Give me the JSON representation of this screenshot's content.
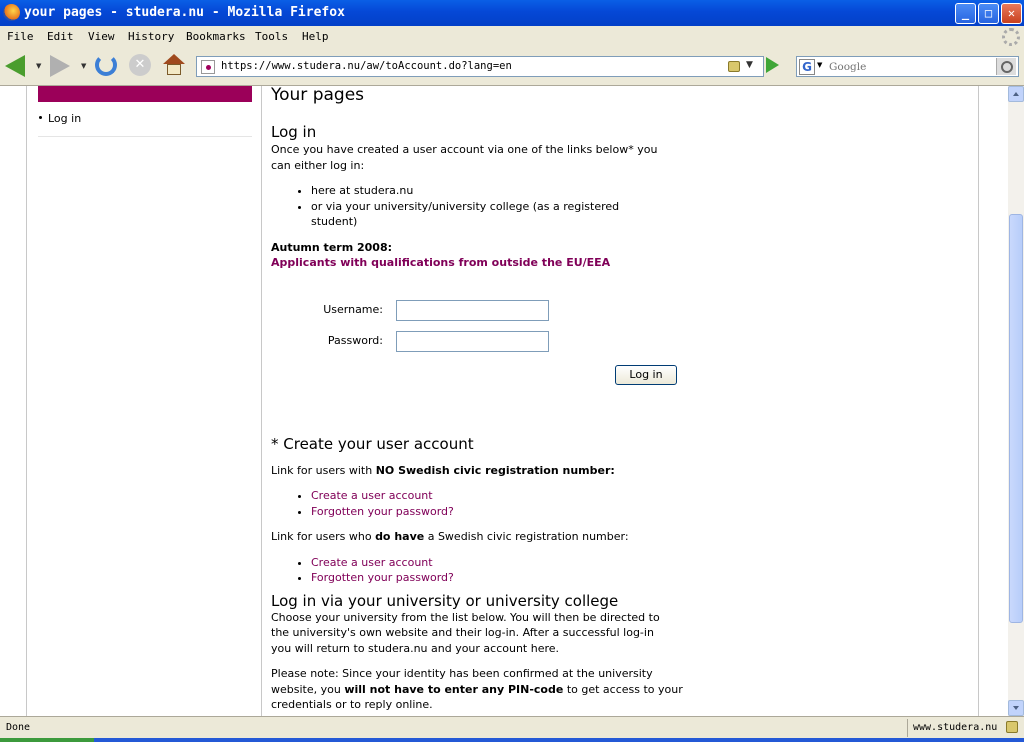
{
  "window": {
    "title": "your pages - studera.nu - Mozilla Firefox",
    "controls": {
      "minimize": "_",
      "maximize": "□",
      "close": "✕"
    }
  },
  "menu": {
    "items": [
      "File",
      "Edit",
      "View",
      "History",
      "Bookmarks",
      "Tools",
      "Help"
    ]
  },
  "toolbar": {
    "url": "https://www.studera.nu/aw/toAccount.do?lang=en",
    "search_placeholder": "Google",
    "stop_glyph": "✕",
    "dropdown_glyph": "▼"
  },
  "sidebar": {
    "items": [
      {
        "label": "Log in"
      }
    ]
  },
  "main": {
    "page_title": "Your pages",
    "login": {
      "heading": "Log in",
      "intro": "Once you have created a user account via one of the links below* you can either log in:",
      "options": [
        "here at studera.nu",
        "or via your university/university college (as a registered student)"
      ],
      "term_label": "Autumn term 2008:",
      "term_link": "Applicants with qualifications from outside the EU/EEA",
      "username_label": "Username:",
      "password_label": "Password:",
      "submit_label": "Log in"
    },
    "create_account": {
      "heading": "* Create your user account",
      "no_pin": {
        "prefix": "Link for users with ",
        "bold": "NO Swedish civic registration number:",
        "links": [
          "Create a user account",
          "Forgotten your password?"
        ]
      },
      "with_pin": {
        "prefix": "Link for users who ",
        "bold": "do have",
        "suffix": " a Swedish civic registration number:",
        "links": [
          "Create a user account",
          "Forgotten your password?"
        ]
      }
    },
    "university_login": {
      "heading": "Log in via your university or university college",
      "intro": "Choose your university from the list below. You will then be directed to the university's own website and their log-in. After a successful log-in you will return to studera.nu and your account here.",
      "note_prefix": "Please note: Since your identity has been confirmed at the university website, you ",
      "note_bold": "will not have to enter any PIN-code",
      "note_suffix": " to get access to your credentials or to reply online."
    }
  },
  "status": {
    "text": "Done",
    "host": "www.studera.nu"
  }
}
